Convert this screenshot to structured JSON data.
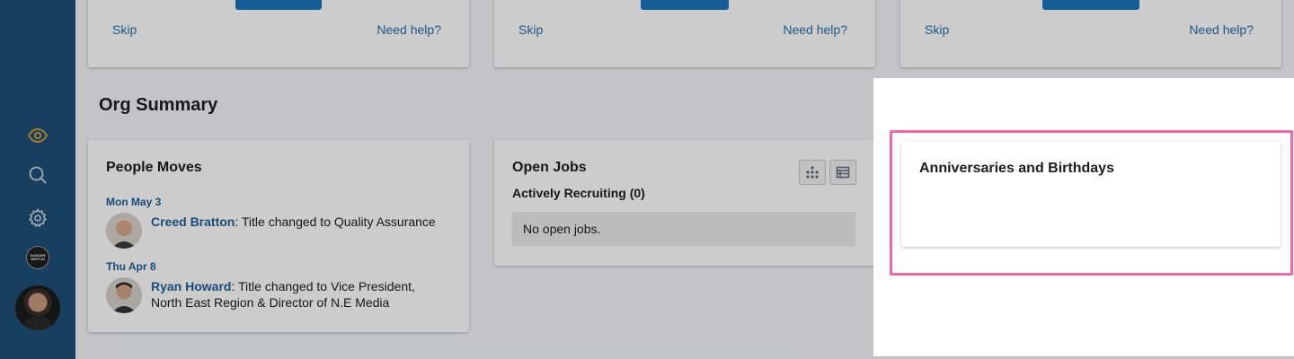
{
  "top_cards": [
    {
      "skip_label": "Skip",
      "help_label": "Need help?"
    },
    {
      "skip_label": "Skip",
      "help_label": "Need help?"
    },
    {
      "skip_label": "Skip",
      "help_label": "Need help?"
    }
  ],
  "sidebar": {
    "icons": [
      "eye-icon",
      "search-icon",
      "gear-icon"
    ],
    "org_logo_text": "DUNDER MIFFLIN",
    "accent_color": "#e0a030"
  },
  "org_summary": {
    "title": "Org Summary",
    "people_moves": {
      "title": "People Moves",
      "entries": [
        {
          "date": "Mon May 3",
          "person": "Creed Bratton",
          "text": ": Title changed to Quality Assurance"
        },
        {
          "date": "Thu Apr 8",
          "person": "Ryan Howard",
          "text": ": Title changed to Vice President, North East Region & Director of N.E Media"
        }
      ]
    },
    "open_jobs": {
      "title": "Open Jobs",
      "subtitle": "Actively Recruiting (0)",
      "empty_text": "No open jobs.",
      "view_buttons": [
        "org-chart-view-icon",
        "table-view-icon"
      ]
    },
    "anniversaries": {
      "title": "Anniversaries and Birthdays"
    }
  },
  "colors": {
    "sidebar": "#1f4f78",
    "link": "#2a6ea6",
    "primary_button": "#1a75bb",
    "highlight_border": "#ed6aa6"
  }
}
